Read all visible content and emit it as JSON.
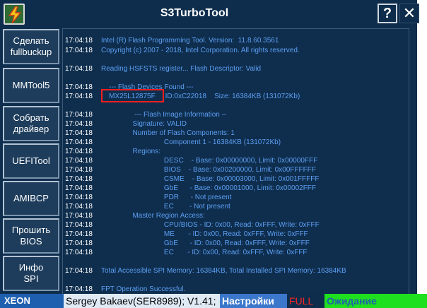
{
  "window": {
    "title": "S3TurboTool",
    "help_label": "?",
    "close_label": "✕"
  },
  "sidebar": {
    "items": [
      {
        "label": "Сделать\nfullbuckup"
      },
      {
        "label": "MMTool5"
      },
      {
        "label": "Собрать\nдрайвер"
      },
      {
        "label": "UEFITool"
      },
      {
        "label": "AMIBCP"
      },
      {
        "label": "Прошить\nBIOS"
      },
      {
        "label": "Инфо\nSPI"
      }
    ]
  },
  "log": {
    "lines": [
      {
        "time": "17:04:18",
        "text": "Intel (R) Flash Programming Tool. Version:  11.8.60.3561"
      },
      {
        "time": "17:04:18",
        "text": "Copyright (c) 2007 - 2018, Intel Corporation. All rights reserved."
      },
      {
        "time": "",
        "text": ""
      },
      {
        "time": "17:04:18",
        "text": "Reading HSFSTS register... Flash Descriptor: Valid"
      },
      {
        "time": "",
        "text": ""
      },
      {
        "time": "17:04:18",
        "text": "    --- Flash Devices Found ---"
      },
      {
        "time": "17:04:18",
        "text": "    MX25L12875F     ID:0xC22018    Size: 16384KB (131072Kb)"
      },
      {
        "time": "",
        "text": ""
      },
      {
        "time": "17:04:18",
        "text": "                 --- Flash Image Information --"
      },
      {
        "time": "17:04:18",
        "text": "                Signature: VALID"
      },
      {
        "time": "17:04:18",
        "text": "                Number of Flash Components: 1"
      },
      {
        "time": "17:04:18",
        "text": "                                Component 1 - 16384KB (131072Kb)"
      },
      {
        "time": "17:04:18",
        "text": "                Regions:"
      },
      {
        "time": "17:04:18",
        "text": "                                DESC    - Base: 0x00000000, Limit: 0x00000FFF"
      },
      {
        "time": "17:04:18",
        "text": "                                BIOS    - Base: 0x00200000, Limit: 0x00FFFFFF"
      },
      {
        "time": "17:04:18",
        "text": "                                CSME    - Base: 0x00003000, Limit: 0x001FFFFF"
      },
      {
        "time": "17:04:18",
        "text": "                                GbE      - Base: 0x00001000, Limit: 0x00002FFF"
      },
      {
        "time": "17:04:18",
        "text": "                                PDR      - Not present"
      },
      {
        "time": "17:04:18",
        "text": "                                EC        - Not present"
      },
      {
        "time": "17:04:18",
        "text": "                Master Region Access:"
      },
      {
        "time": "17:04:18",
        "text": "                                CPU/BIOS - ID: 0x00, Read: 0xFFF, Write: 0xFFF"
      },
      {
        "time": "17:04:18",
        "text": "                                ME       - ID: 0x00, Read: 0xFFF, Write: 0xFFF"
      },
      {
        "time": "17:04:18",
        "text": "                                GbE      - ID: 0x00, Read: 0xFFF, Write: 0xFFF"
      },
      {
        "time": "17:04:18",
        "text": "                                EC       - ID: 0x00, Read: 0xFFF, Write: 0xFFF"
      },
      {
        "time": "",
        "text": ""
      },
      {
        "time": "17:04:18",
        "text": "Total Accessible SPI Memory: 16384KB, Total Installed SPI Memory: 16384KB"
      },
      {
        "time": "",
        "text": ""
      },
      {
        "time": "17:04:18",
        "text": "FPT Operation Successful."
      }
    ]
  },
  "statusbar": {
    "cpu": "XEON",
    "author": "Sergey Bakaev(SER8989); V1.41;",
    "settings": "Настройки",
    "mode": "FULL",
    "state": "Ожидание"
  },
  "colors": {
    "background": "#0f2e4e",
    "log_text": "#5c9ff2",
    "highlight": "#ff1e1e",
    "status_wait": "#1fe01f"
  }
}
